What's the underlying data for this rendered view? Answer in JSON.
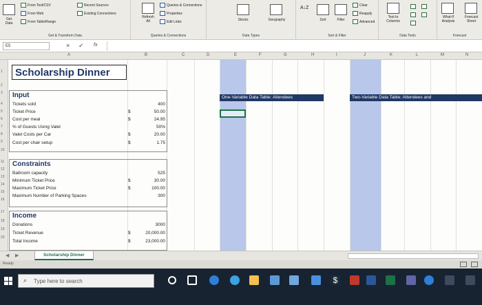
{
  "ribbon": {
    "get_data": {
      "label1": "Get",
      "label2": "Data",
      "from_csv": "From Text/CSV",
      "from_web": "From Web",
      "from_table": "From Table/Range",
      "recent_sources": "Recent Sources",
      "existing_connections": "Existing Connections",
      "group_label": "Get & Transform Data"
    },
    "queries": {
      "refresh_all1": "Refresh",
      "refresh_all2": "All",
      "queries_connections": "Queries & Connections",
      "properties": "Properties",
      "edit_links": "Edit Links",
      "group_label": "Queries & Connections"
    },
    "data_types": {
      "stocks": "Stocks",
      "geography": "Geography",
      "group_label": "Data Types"
    },
    "sort_filter": {
      "sort": "Sort",
      "filter": "Filter",
      "clear": "Clear",
      "reapply": "Reapply",
      "advanced": "Advanced",
      "group_label": "Sort & Filter"
    },
    "data_tools": {
      "text_to_columns1": "Text to",
      "text_to_columns2": "Columns",
      "group_label": "Data Tools"
    },
    "forecast": {
      "what_if1": "What-If",
      "what_if2": "Analysis",
      "forecast_sheet1": "Forecast",
      "forecast_sheet2": "Sheet",
      "group_label": "Forecast"
    }
  },
  "formula_bar": {
    "name_box": "E5",
    "cancel": "×",
    "enter": "✓",
    "fx": "fx"
  },
  "columns": [
    "A",
    "B",
    "C",
    "D",
    "E",
    "F",
    "G",
    "H",
    "I",
    "J",
    "K",
    "L",
    "M",
    "N"
  ],
  "rows": [
    "1",
    "2",
    "3",
    "4",
    "5",
    "6",
    "7",
    "8",
    "9",
    "10",
    "11",
    "12",
    "13",
    "14",
    "15",
    "16",
    "17",
    "18",
    "19",
    "20"
  ],
  "sheet": {
    "title": "Scholarship Dinner",
    "input_header": "Input",
    "inputs": [
      {
        "label": "Tickets sold",
        "dollar": "",
        "value": "400"
      },
      {
        "label": "Ticket Price",
        "dollar": "$",
        "value": "50.00"
      },
      {
        "label": "Cost per meal",
        "dollar": "$",
        "value": "24.95"
      },
      {
        "label": "% of Guests Using Valet",
        "dollar": "",
        "value": "50%"
      },
      {
        "label": "Valet Costs per Car",
        "dollar": "$",
        "value": "20.00"
      },
      {
        "label": "Cost per chair setup",
        "dollar": "$",
        "value": "1.75"
      }
    ],
    "constraints_header": "Constraints",
    "constraints": [
      {
        "label": "Ballroom capacity",
        "dollar": "",
        "value": "525"
      },
      {
        "label": "Minimum Ticket Price",
        "dollar": "$",
        "value": "30.00"
      },
      {
        "label": "Maximum Ticket Price",
        "dollar": "$",
        "value": "100.00"
      },
      {
        "label": "Maximum Number of Parking Spaces",
        "dollar": "",
        "value": "300"
      }
    ],
    "income_header": "Income",
    "income": [
      {
        "label": "Donations",
        "dollar": "",
        "value": "3000"
      },
      {
        "label": "Ticket Revenue",
        "dollar": "$",
        "value": "20,000.00"
      },
      {
        "label": "Total Income",
        "dollar": "$",
        "value": "23,000.00"
      }
    ],
    "one_var_header": "One-Variable Data Table: Attendees",
    "two_var_header": "Two-Variable Data Table: Attendees and"
  },
  "tabs": {
    "active": "Scholarship Dinner"
  },
  "status": {
    "text": "Ready"
  },
  "taskbar": {
    "search_placeholder": "Type here to search"
  },
  "colors": {
    "header_fill": "#1f3864",
    "band": "#b8c7ea",
    "accent": "#1e7145"
  }
}
